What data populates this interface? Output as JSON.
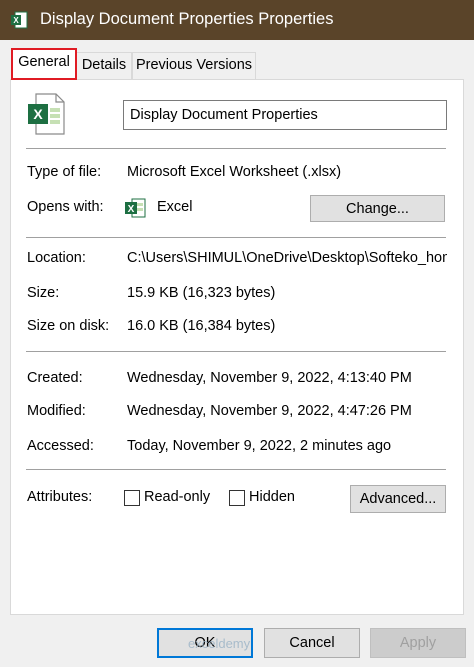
{
  "window": {
    "title": "Display Document Properties Properties",
    "title_icon": "excel-icon"
  },
  "tabs": [
    {
      "label": "General",
      "active": true
    },
    {
      "label": "Details",
      "active": false
    },
    {
      "label": "Previous Versions",
      "active": false
    }
  ],
  "file": {
    "name": "Display Document Properties",
    "icon": "excel-file-icon"
  },
  "rows": {
    "type_label": "Type of file:",
    "type_value": "Microsoft Excel Worksheet (.xlsx)",
    "opens_label": "Opens with:",
    "opens_value": "Excel",
    "change_button": "Change...",
    "location_label": "Location:",
    "location_value": "C:\\Users\\SHIMUL\\OneDrive\\Desktop\\Softeko_home",
    "size_label": "Size:",
    "size_value": "15.9 KB (16,323 bytes)",
    "size_disk_label": "Size on disk:",
    "size_disk_value": "16.0 KB (16,384 bytes)",
    "created_label": "Created:",
    "created_value": "Wednesday, November 9, 2022, 4:13:40 PM",
    "modified_label": "Modified:",
    "modified_value": "Wednesday, November 9, 2022, 4:47:26 PM",
    "accessed_label": "Accessed:",
    "accessed_value": "Today, November 9, 2022, 2 minutes ago"
  },
  "attributes": {
    "label": "Attributes:",
    "readonly_label": "Read-only",
    "readonly_checked": false,
    "hidden_label": "Hidden",
    "hidden_checked": false,
    "advanced_button": "Advanced..."
  },
  "footer": {
    "ok": "OK",
    "cancel": "Cancel",
    "apply": "Apply",
    "watermark": "exceldemy"
  },
  "colors": {
    "titlebar": "#5a4429",
    "highlight": "#e01b24",
    "excel_green": "#1d6f42"
  }
}
